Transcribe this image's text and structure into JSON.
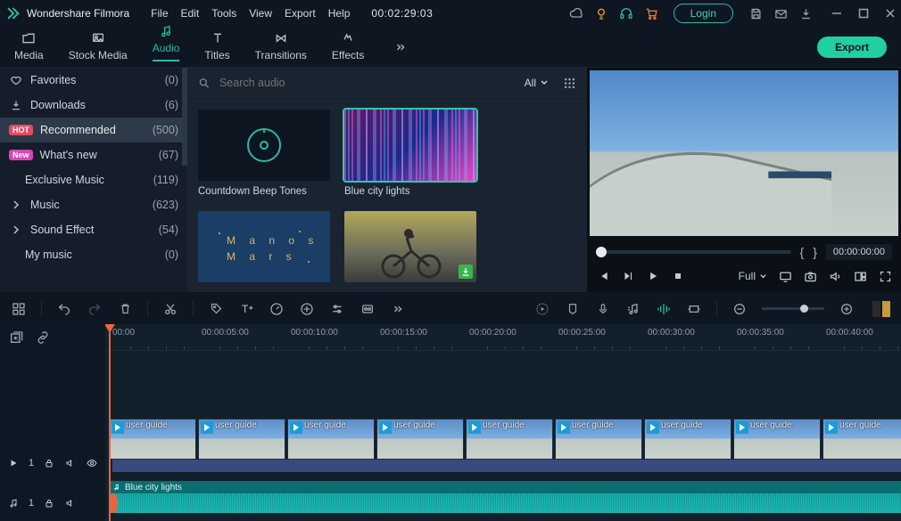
{
  "app": {
    "name": "Wondershare Filmora"
  },
  "menu": [
    "File",
    "Edit",
    "Tools",
    "View",
    "Export",
    "Help"
  ],
  "titlebar_timecode": "00:02:29:03",
  "login_label": "Login",
  "tabs": [
    {
      "label": "Media"
    },
    {
      "label": "Stock Media"
    },
    {
      "label": "Audio"
    },
    {
      "label": "Titles"
    },
    {
      "label": "Transitions"
    },
    {
      "label": "Effects"
    }
  ],
  "export_label": "Export",
  "sidebar": [
    {
      "icon": "heart",
      "label": "Favorites",
      "count": "(0)"
    },
    {
      "icon": "download",
      "label": "Downloads",
      "count": "(6)"
    },
    {
      "badge": "HOT",
      "label": "Recommended",
      "count": "(500)",
      "selected": true
    },
    {
      "badge": "New",
      "label": "What's new",
      "count": "(67)"
    },
    {
      "indent": true,
      "label": "Exclusive Music",
      "count": "(119)"
    },
    {
      "icon": "caret",
      "label": "Music",
      "count": "(623)"
    },
    {
      "icon": "caret",
      "label": "Sound Effect",
      "count": "(54)"
    },
    {
      "indent": true,
      "label": "My music",
      "count": "(0)"
    }
  ],
  "search": {
    "placeholder": "Search audio",
    "filter": "All"
  },
  "assets": [
    {
      "label": "Countdown Beep Tones",
      "kind": "tone"
    },
    {
      "label": "Blue city lights",
      "kind": "city",
      "selected": true
    },
    {
      "label": "",
      "kind": "manos"
    },
    {
      "label": "",
      "kind": "bike",
      "download": true
    }
  ],
  "preview": {
    "mark_in": "{",
    "mark_out": "}",
    "timecode": "00:00:00:00",
    "quality": "Full"
  },
  "ruler_ticks": [
    "00:00",
    "00:00:05:00",
    "00:00:10:00",
    "00:00:15:00",
    "00:00:20:00",
    "00:00:25:00",
    "00:00:30:00",
    "00:00:35:00",
    "00:00:40:00"
  ],
  "video_clip_label": "user guide",
  "audio_clip_label": "Blue city lights",
  "track_heads": {
    "video": "1",
    "audio": "1"
  }
}
